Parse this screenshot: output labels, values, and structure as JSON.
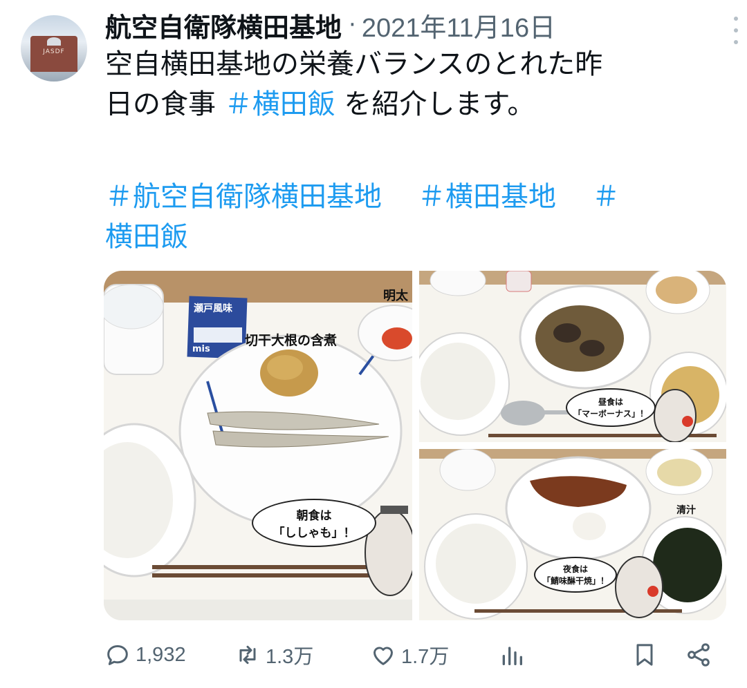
{
  "author": {
    "name": "航空自衛隊横田基地",
    "separator": "·",
    "date": "2021年11月16日",
    "avatar_text": "JASDF"
  },
  "tweet": {
    "line1": "空自横田基地の栄養バランスのとれた昨",
    "line2_pre": "日の食事 ",
    "line2_tag": "＃横田飯",
    "line2_post": " を紹介します。"
  },
  "hashtags": {
    "tag1": "＃航空自衛隊横田基地",
    "tag2": "＃横田基地",
    "tag3": "＃",
    "tag3_cont": "横田飯"
  },
  "media": {
    "photo1": {
      "caption_dish": "切干大根の含煮",
      "caption_corner": "明太",
      "sauce_label": "瀬戸風味",
      "sauce_sub": "mis",
      "bubble_line1": "朝食は",
      "bubble_line2": "「ししゃも」！"
    },
    "photo2": {
      "bubble_line1": "昼食は",
      "bubble_line2": "「マーボーナス」！"
    },
    "photo3": {
      "caption_soup": "清汁",
      "bubble_line1": "夜食は",
      "bubble_line2": "「鯖味醂干焼」！"
    }
  },
  "actions": {
    "replies": "1,932",
    "retweets": "1.3万",
    "likes": "1.7万"
  },
  "colors": {
    "hashtag": "#1d9bf0",
    "meta": "#536471",
    "text": "#0f1419"
  },
  "icons": [
    "more-icon",
    "reply-icon",
    "retweet-icon",
    "like-icon",
    "views-icon",
    "bookmark-icon",
    "share-icon"
  ]
}
